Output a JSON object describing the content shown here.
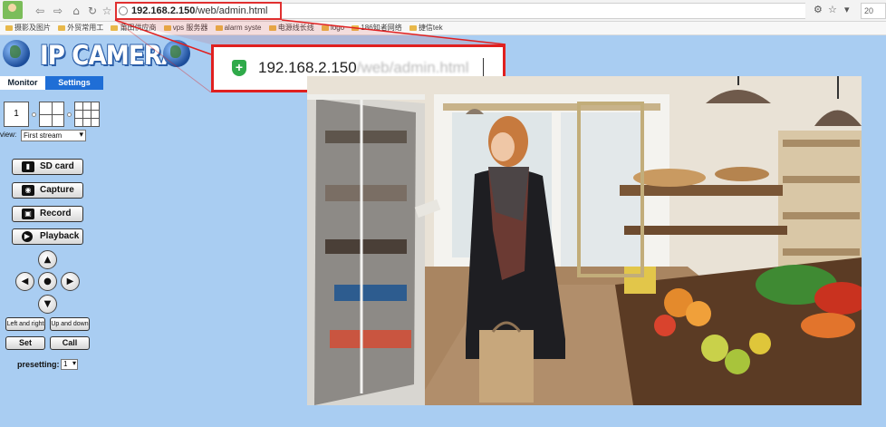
{
  "browser": {
    "url_host": "192.168.2.150",
    "url_path": "/web/admin.html",
    "search_text": "20",
    "bookmarks": [
      "摄影及图片",
      "外贸常用工",
      "莆田供应商",
      "vps 服务器",
      "alarm syste",
      "电源线长线",
      "logo",
      "186知者网络",
      "捷信tek"
    ]
  },
  "zoom_callout": {
    "host": "192.168.2.150",
    "path": "/web/admin.html"
  },
  "header": {
    "title": "IP CAMERA"
  },
  "tabs": {
    "monitor": "Monitor",
    "settings": "Settings"
  },
  "layout": {
    "single": "1"
  },
  "view": {
    "label": "view:",
    "selected": "First stream"
  },
  "actions": {
    "sd_card": "SD card",
    "capture": "Capture",
    "record": "Record",
    "playback": "Playback"
  },
  "ptz": {
    "left_right": "Left and right",
    "up_down": "Up and down",
    "set": "Set",
    "call": "Call",
    "preset_label": "presetting:",
    "preset_value": "1"
  },
  "icons": {
    "up": "arrow-up-icon",
    "down": "arrow-down-icon",
    "left": "arrow-left-icon",
    "right": "arrow-right-icon",
    "center": "center-stop-icon"
  },
  "colors": {
    "page_bg": "#a9cdf2",
    "tab_active_bg": "#1f6ed6",
    "highlight": "#e02020"
  }
}
